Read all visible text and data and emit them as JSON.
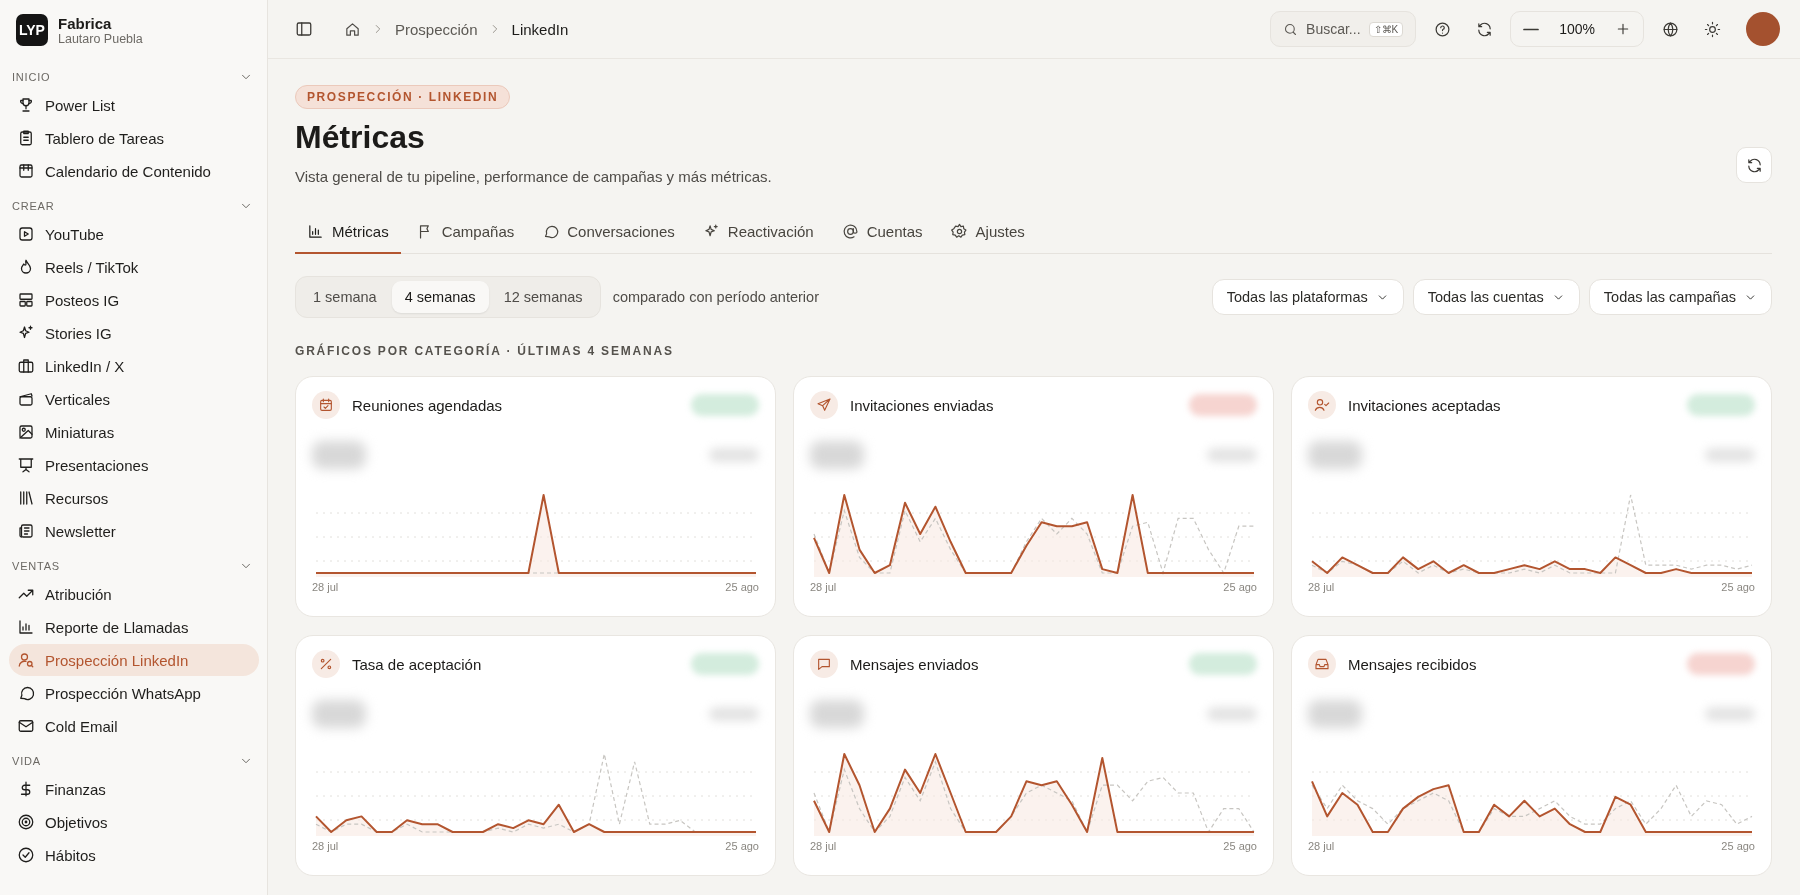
{
  "workspace": {
    "logo": "LYP",
    "name": "Fabrica",
    "user": "Lautaro Puebla"
  },
  "sidebar": {
    "sections": [
      {
        "title": "INICIO",
        "expanded": true,
        "items": [
          {
            "label": "Power List",
            "selected": false
          },
          {
            "label": "Tablero de Tareas",
            "selected": false
          },
          {
            "label": "Calendario de Contenido",
            "selected": false
          }
        ]
      },
      {
        "title": "CREAR",
        "expanded": true,
        "items": [
          {
            "label": "YouTube",
            "selected": false
          },
          {
            "label": "Reels / TikTok",
            "selected": false
          },
          {
            "label": "Posteos IG",
            "selected": false
          },
          {
            "label": "Stories IG",
            "selected": false
          },
          {
            "label": "LinkedIn / X",
            "selected": false
          },
          {
            "label": "Verticales",
            "selected": false
          },
          {
            "label": "Miniaturas",
            "selected": false
          },
          {
            "label": "Presentaciones",
            "selected": false
          },
          {
            "label": "Recursos",
            "selected": false
          },
          {
            "label": "Newsletter",
            "selected": false
          }
        ]
      },
      {
        "title": "VENTAS",
        "expanded": true,
        "items": [
          {
            "label": "Atribución",
            "selected": false
          },
          {
            "label": "Reporte de Llamadas",
            "selected": false
          },
          {
            "label": "Prospección LinkedIn",
            "selected": true
          },
          {
            "label": "Prospección WhatsApp",
            "selected": false
          },
          {
            "label": "Cold Email",
            "selected": false
          }
        ]
      },
      {
        "title": "VIDA",
        "expanded": true,
        "items": [
          {
            "label": "Finanzas",
            "selected": false
          },
          {
            "label": "Objetivos",
            "selected": false
          },
          {
            "label": "Hábitos",
            "selected": false
          }
        ]
      }
    ]
  },
  "breadcrumb": [
    "Prospección",
    "LinkedIn"
  ],
  "search": {
    "placeholder": "Buscar...",
    "shortcut": "⇧⌘K"
  },
  "zoom": {
    "value": "100%"
  },
  "page": {
    "eyebrow": "PROSPECCIÓN · LINKEDIN",
    "title": "Métricas",
    "subtitle": "Vista general de tu pipeline, performance de campañas y más métricas."
  },
  "tabs": [
    {
      "label": "Métricas",
      "selected": true
    },
    {
      "label": "Campañas",
      "selected": false
    },
    {
      "label": "Conversaciones",
      "selected": false
    },
    {
      "label": "Reactivación",
      "selected": false
    },
    {
      "label": "Cuentas",
      "selected": false
    },
    {
      "label": "Ajustes",
      "selected": false
    }
  ],
  "ranges": [
    {
      "label": "1 semana",
      "selected": false
    },
    {
      "label": "4 semanas",
      "selected": true
    },
    {
      "label": "12 semanas",
      "selected": false
    }
  ],
  "comparison": "comparado con período anterior",
  "filters": [
    "Todas las plataformas",
    "Todas las cuentas",
    "Todas las campañas"
  ],
  "section_title": "GRÁFICOS POR CATEGORÍA · ÚLTIMAS 4 SEMANAS",
  "cards": [
    {
      "title": "Reuniones agendadas",
      "color": "#d3ecdd",
      "start": "28 jul",
      "end": "25 ago"
    },
    {
      "title": "Invitaciones enviadas",
      "color": "#f6d4d0",
      "start": "28 jul",
      "end": "25 ago"
    },
    {
      "title": "Invitaciones aceptadas",
      "color": "#d3ecdd",
      "start": "28 jul",
      "end": "25 ago"
    },
    {
      "title": "Tasa de aceptación",
      "color": "#d3ecdd",
      "start": "28 jul",
      "end": "25 ago"
    },
    {
      "title": "Mensajes enviados",
      "color": "#d3ecdd",
      "start": "28 jul",
      "end": "25 ago"
    },
    {
      "title": "Mensajes recibidos",
      "color": "#f6d4d0",
      "start": "28 jul",
      "end": "25 ago"
    }
  ]
}
